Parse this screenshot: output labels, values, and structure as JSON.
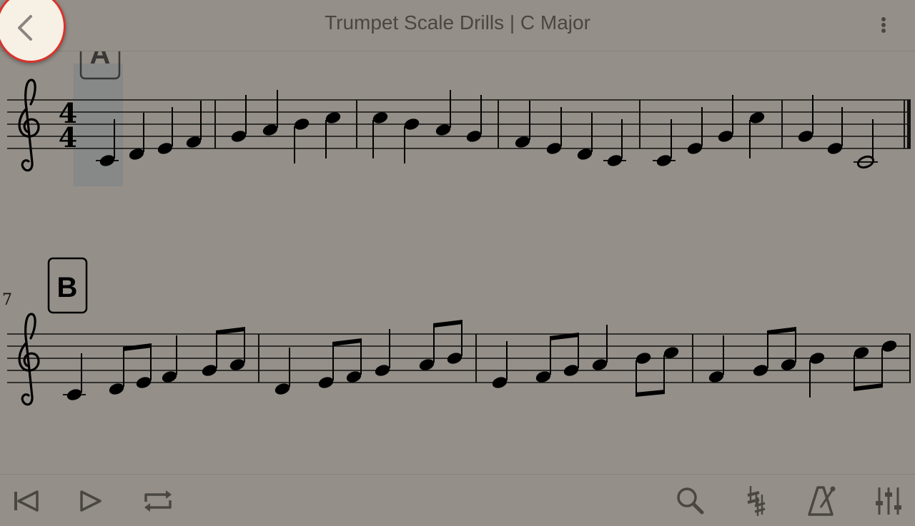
{
  "header": {
    "title": "Trumpet Scale Drills | C Major",
    "back_icon": "chevron-left-icon",
    "menu_icon": "more-vertical-icon"
  },
  "score": {
    "rehearsal_marks": [
      "A",
      "B"
    ],
    "time_signature": {
      "numerator": "4",
      "denominator": "4"
    },
    "measure_number_line2": "7"
  },
  "toolbar": {
    "icons": [
      "skip-to-start-icon",
      "play-icon",
      "repeat-icon",
      "search-icon",
      "transpose-icon",
      "metronome-icon",
      "mixer-icon"
    ]
  },
  "colors": {
    "background": "#948f88",
    "title_text": "#4a4642",
    "back_button_fill": "#f7f0e4",
    "back_button_ring": "#d9322b",
    "highlight": "#7c8488"
  }
}
